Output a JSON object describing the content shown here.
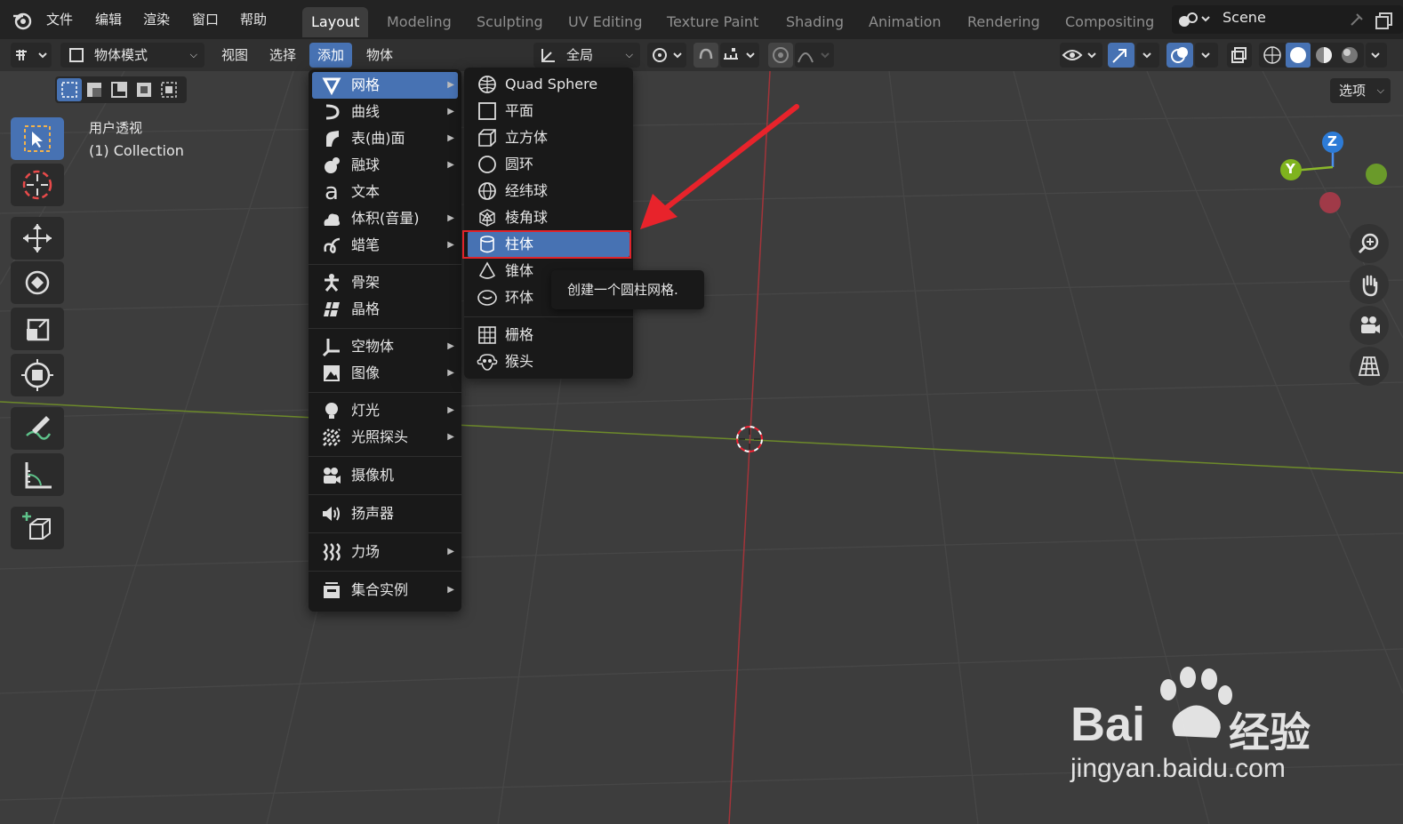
{
  "top_menu": [
    "文件",
    "编辑",
    "渲染",
    "窗口",
    "帮助"
  ],
  "workspace_tabs": [
    {
      "label": "Layout",
      "active": true
    },
    {
      "label": "Modeling"
    },
    {
      "label": "Sculpting"
    },
    {
      "label": "UV Editing"
    },
    {
      "label": "Texture Paint"
    },
    {
      "label": "Shading"
    },
    {
      "label": "Animation"
    },
    {
      "label": "Rendering"
    },
    {
      "label": "Compositing"
    }
  ],
  "scene": {
    "name": "Scene"
  },
  "header": {
    "mode": "物体模式",
    "menus": [
      "视图",
      "选择",
      "添加",
      "物体"
    ],
    "active_menu": "添加",
    "transform": "全局",
    "options": "选项"
  },
  "viewport": {
    "view_name": "用户透视",
    "collection": "(1) Collection",
    "gizmo": {
      "z": "Z",
      "y": "Y"
    }
  },
  "add_menu": {
    "items": [
      {
        "label": "网格",
        "icon": "mesh-icon",
        "sub": true,
        "hl": true
      },
      {
        "label": "曲线",
        "icon": "curve-icon",
        "sub": true
      },
      {
        "label": "表(曲)面",
        "icon": "surface-icon",
        "sub": true
      },
      {
        "label": "融球",
        "icon": "metaball-icon",
        "sub": true
      },
      {
        "label": "文本",
        "icon": "text-icon",
        "sub": false
      },
      {
        "label": "体积(音量)",
        "icon": "volume-icon",
        "sub": true
      },
      {
        "label": "蜡笔",
        "icon": "grease-pencil-icon",
        "sub": true
      },
      {
        "label": "骨架",
        "icon": "armature-icon",
        "sub": false
      },
      {
        "label": "晶格",
        "icon": "lattice-icon",
        "sub": false
      },
      {
        "label": "空物体",
        "icon": "empty-icon",
        "sub": true
      },
      {
        "label": "图像",
        "icon": "image-icon",
        "sub": true
      },
      {
        "label": "灯光",
        "icon": "light-icon",
        "sub": true
      },
      {
        "label": "光照探头",
        "icon": "light-probe-icon",
        "sub": true
      },
      {
        "label": "摄像机",
        "icon": "camera-icon",
        "sub": false
      },
      {
        "label": "扬声器",
        "icon": "speaker-icon",
        "sub": false
      },
      {
        "label": "力场",
        "icon": "force-field-icon",
        "sub": true
      },
      {
        "label": "集合实例",
        "icon": "collection-instance-icon",
        "sub": true
      }
    ]
  },
  "mesh_menu": {
    "items": [
      {
        "label": "Quad Sphere",
        "icon": "quad-sphere-icon"
      },
      {
        "label": "平面",
        "icon": "plane-icon"
      },
      {
        "label": "立方体",
        "icon": "cube-icon"
      },
      {
        "label": "圆环",
        "icon": "circle-icon"
      },
      {
        "label": "经纬球",
        "icon": "uv-sphere-icon"
      },
      {
        "label": "棱角球",
        "icon": "ico-sphere-icon"
      },
      {
        "label": "柱体",
        "icon": "cylinder-icon",
        "hl": true
      },
      {
        "label": "锥体",
        "icon": "cone-icon"
      },
      {
        "label": "环体",
        "icon": "torus-icon"
      },
      {
        "label": "栅格",
        "icon": "grid-icon"
      },
      {
        "label": "猴头",
        "icon": "monkey-icon"
      }
    ]
  },
  "tooltip": "创建一个圆柱网格.",
  "watermark": {
    "brand": "Bai",
    "brand2": "经验",
    "url": "jingyan.baidu.com"
  },
  "colors": {
    "accent": "#4772b3",
    "highlight_border": "#e0232a",
    "arrow": "#e8232b"
  }
}
